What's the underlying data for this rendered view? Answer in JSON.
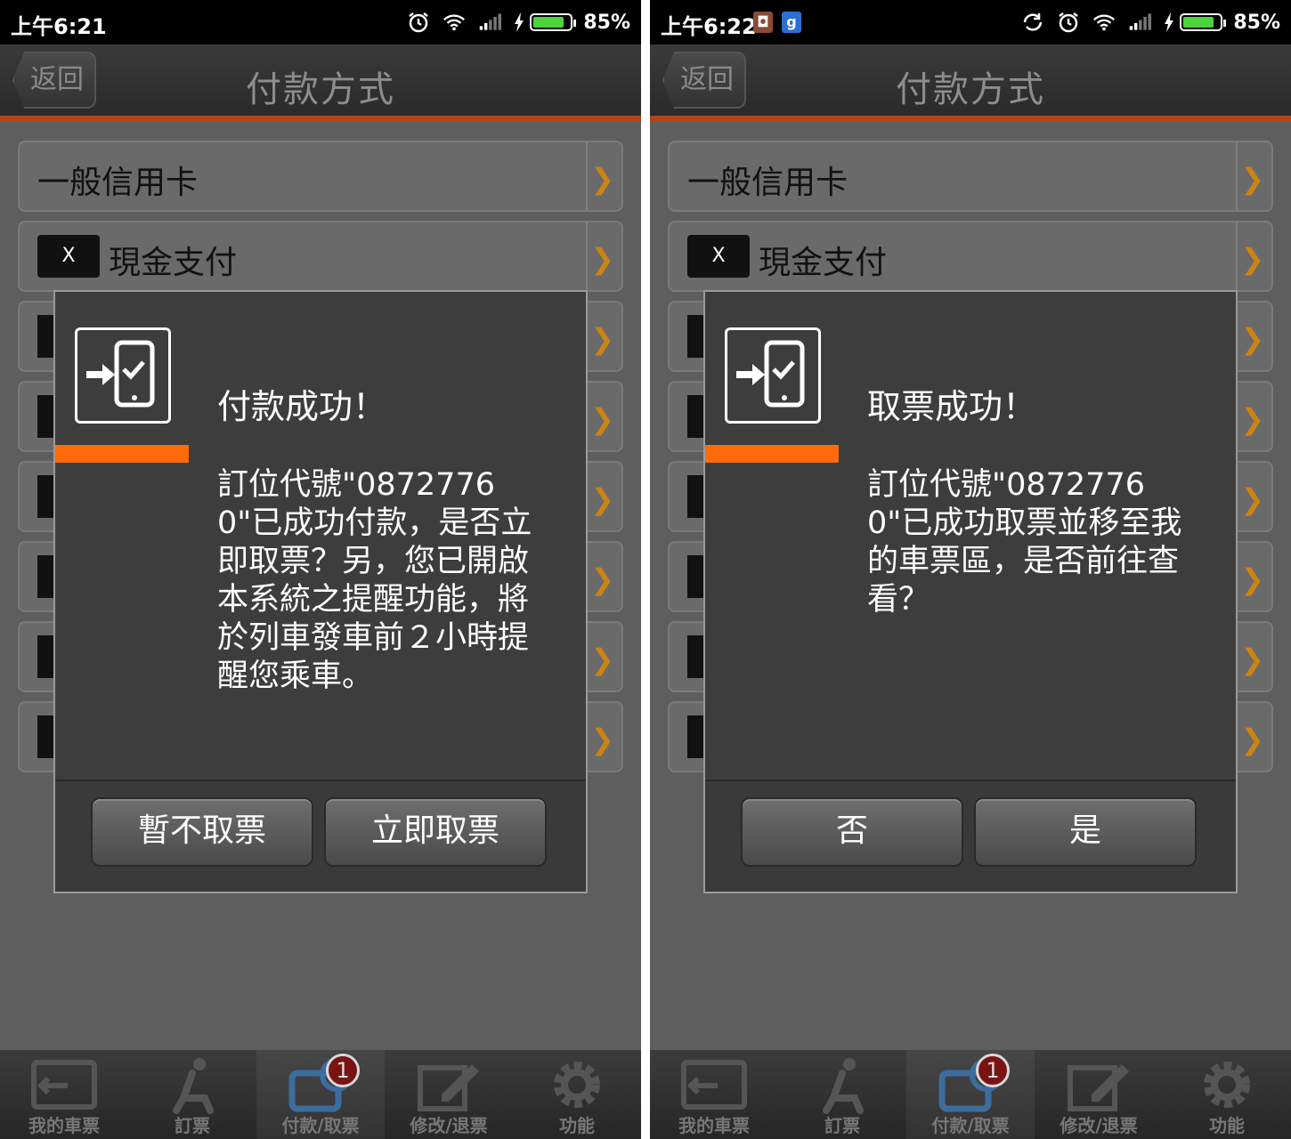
{
  "screens": [
    {
      "status": {
        "time": "上午6:21",
        "battery": "85%",
        "app_icons": []
      },
      "header": {
        "back_label": "返回",
        "title": "付款方式"
      },
      "list": [
        {
          "label": "一般信用卡",
          "has_card": false
        },
        {
          "label": "現金支付",
          "has_card": true,
          "card_text": "X"
        }
      ],
      "dialog": {
        "title": "付款成功！",
        "message": "訂位代號\"08727760\"已成功付款，是否立即取票？另，您已開啟本系統之提醒功能，將於列車發車前２小時提醒您乘車。",
        "buttons": [
          "暫不取票",
          "立即取票"
        ]
      },
      "nav": [
        {
          "label": "我的車票",
          "icon": "ticket-icon"
        },
        {
          "label": "訂票",
          "icon": "seat-icon"
        },
        {
          "label": "付款/取票",
          "icon": "payment-icon",
          "badge": "1"
        },
        {
          "label": "修改/退票",
          "icon": "edit-icon"
        },
        {
          "label": "功能",
          "icon": "gear-icon"
        }
      ]
    },
    {
      "status": {
        "time": "上午6:22",
        "battery": "85%",
        "app_icons": [
          "◘",
          "g"
        ]
      },
      "header": {
        "back_label": "返回",
        "title": "付款方式"
      },
      "list": [
        {
          "label": "一般信用卡",
          "has_card": false
        },
        {
          "label": "現金支付",
          "has_card": true,
          "card_text": "X"
        }
      ],
      "dialog": {
        "title": "取票成功！",
        "message": "訂位代號\"08727760\"已成功取票並移至我的車票區，是否前往查看？",
        "buttons": [
          "否",
          "是"
        ]
      },
      "nav": [
        {
          "label": "我的車票",
          "icon": "ticket-icon"
        },
        {
          "label": "訂票",
          "icon": "seat-icon"
        },
        {
          "label": "付款/取票",
          "icon": "payment-icon",
          "badge": "1"
        },
        {
          "label": "修改/退票",
          "icon": "edit-icon"
        },
        {
          "label": "功能",
          "icon": "gear-icon"
        }
      ]
    }
  ]
}
